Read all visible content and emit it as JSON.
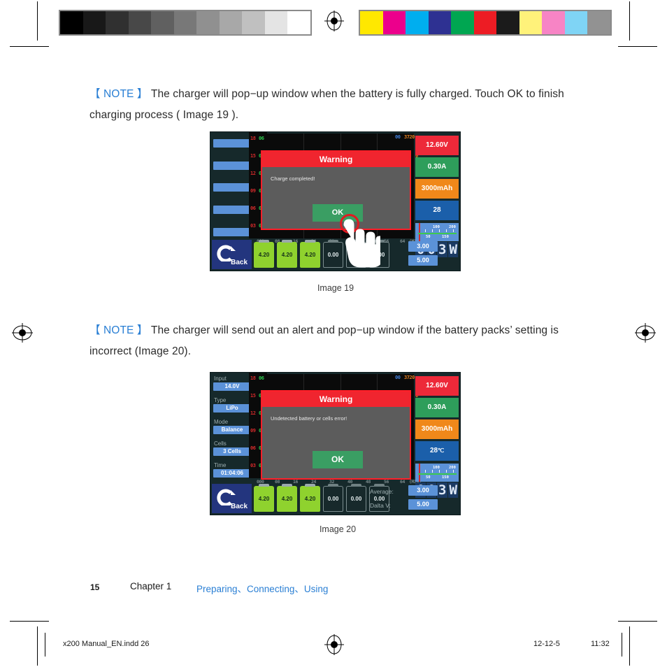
{
  "page": {
    "number": "15",
    "chapter": "Chapter 1",
    "section": "Preparing、Connecting、Using"
  },
  "notes": [
    {
      "tag": "【 NOTE 】",
      "text": " The charger will pop−up window when the battery is fully charged. Touch OK to finish charging process ( Image 19 )."
    },
    {
      "tag": "【 NOTE 】",
      "text": "  The charger will send out an alert and pop−up window if the battery packs’ setting is incorrect (Image 20)."
    }
  ],
  "captions": [
    "Image 19",
    "Image 20"
  ],
  "calibration": {
    "gray_ramp": [
      "#000000",
      "#181818",
      "#303030",
      "#484848",
      "#606060",
      "#787878",
      "#909090",
      "#a8a8a8",
      "#c0c0c0",
      "#e4e4e4",
      "#ffffff"
    ],
    "color_bars": [
      "#ffe800",
      "#ec008c",
      "#00aeef",
      "#2e3192",
      "#00a651",
      "#ed1c24",
      "#1b1b1b",
      "#fff27a",
      "#f784c5",
      "#7fd4f5",
      "#929292"
    ]
  },
  "device19": {
    "sidebar": [
      {
        "label": "",
        "value": ""
      },
      {
        "label": "",
        "value": ""
      },
      {
        "label": "",
        "value": ""
      },
      {
        "label": "",
        "value": ""
      },
      {
        "label": "",
        "value": ""
      },
      {
        "label": "",
        "value": ""
      }
    ],
    "y_axis_red": [
      "18",
      "15",
      "12",
      "09",
      "06",
      "03"
    ],
    "y_axis_green": [
      "06",
      "05",
      "04",
      "03",
      "02",
      "01"
    ],
    "y_axis_right": [
      "0",
      "0",
      "0",
      "0",
      "0",
      "0"
    ],
    "x_axis": [
      "000",
      "08",
      "16",
      "24",
      "32",
      "40",
      "48",
      "56",
      "64"
    ],
    "x_axis_unit": "(MIN)",
    "top_right_blue": "00",
    "top_right_orange": "3720",
    "readouts": [
      {
        "name": "voltage",
        "value": "12.60V",
        "color": "#ed2939"
      },
      {
        "name": "current",
        "value": "0.30A",
        "color": "#2e9e5b"
      },
      {
        "name": "capacity",
        "value": "3000mAh",
        "color": "#f0881a"
      },
      {
        "name": "temperature",
        "value": "28",
        "color": "#1b5faa",
        "unit": ""
      }
    ],
    "gauge": {
      "ticks": [
        "50",
        "100",
        "150",
        "200"
      ]
    },
    "power_display": "003W",
    "back_label": "Back",
    "cells": [
      {
        "value": "4.20",
        "state": "full"
      },
      {
        "value": "4.20",
        "state": "full"
      },
      {
        "value": "4.20",
        "state": "full"
      },
      {
        "value": "0.00",
        "state": "empty"
      },
      {
        "value": "0.00",
        "state": "empty"
      },
      {
        "value": "0.00",
        "state": "empty"
      }
    ],
    "average_label": "",
    "average_value": "3.00",
    "delta_label": "",
    "delta_value": "5.00",
    "dialog": {
      "title": "Warning",
      "message": "Charge completed!",
      "ok_label": "OK"
    }
  },
  "device20": {
    "sidebar": [
      {
        "label": "Input",
        "value": "14.0V"
      },
      {
        "label": "Type",
        "value": "LiPo"
      },
      {
        "label": "Mode",
        "value": "Balance"
      },
      {
        "label": "Cells",
        "value": "3 Cells"
      },
      {
        "label": "Time",
        "value": "01:04:06"
      }
    ],
    "y_axis_red": [
      "18",
      "15",
      "12",
      "09",
      "06",
      "03"
    ],
    "y_axis_green": [
      "06",
      "05",
      "04",
      "03",
      "02",
      "01"
    ],
    "y_axis_right": [
      "0",
      "0",
      "0",
      "0",
      "0",
      "0"
    ],
    "x_axis": [
      "000",
      "08",
      "16",
      "24",
      "32",
      "40",
      "48",
      "56",
      "64"
    ],
    "x_axis_unit": "(MIN)",
    "top_right_blue": "00",
    "top_right_orange": "3720",
    "readouts": [
      {
        "name": "voltage",
        "value": "12.60V",
        "color": "#ed2939"
      },
      {
        "name": "current",
        "value": "0.30A",
        "color": "#2e9e5b"
      },
      {
        "name": "capacity",
        "value": "3000mAh",
        "color": "#f0881a"
      },
      {
        "name": "temperature",
        "value": "28",
        "color": "#1b5faa",
        "unit": "℃"
      }
    ],
    "gauge": {
      "ticks": [
        "50",
        "100",
        "150",
        "200"
      ]
    },
    "power_display": "003W",
    "back_label": "Back",
    "cells": [
      {
        "value": "4.20",
        "state": "full"
      },
      {
        "value": "4.20",
        "state": "full"
      },
      {
        "value": "4.20",
        "state": "full"
      },
      {
        "value": "0.00",
        "state": "empty"
      },
      {
        "value": "0.00",
        "state": "empty"
      },
      {
        "value": "0.00",
        "state": "empty"
      }
    ],
    "average_label": "Average:",
    "average_value": "3.00",
    "delta_label": "Dalta V:",
    "delta_value": "5.00",
    "dialog": {
      "title": "Warning",
      "message": "Undetected battery or cells error!",
      "ok_label": "OK"
    }
  },
  "printer_footer": {
    "filename": "x200 Manual_EN.indd   26",
    "date": "12-12-5",
    "time": "11:32"
  }
}
